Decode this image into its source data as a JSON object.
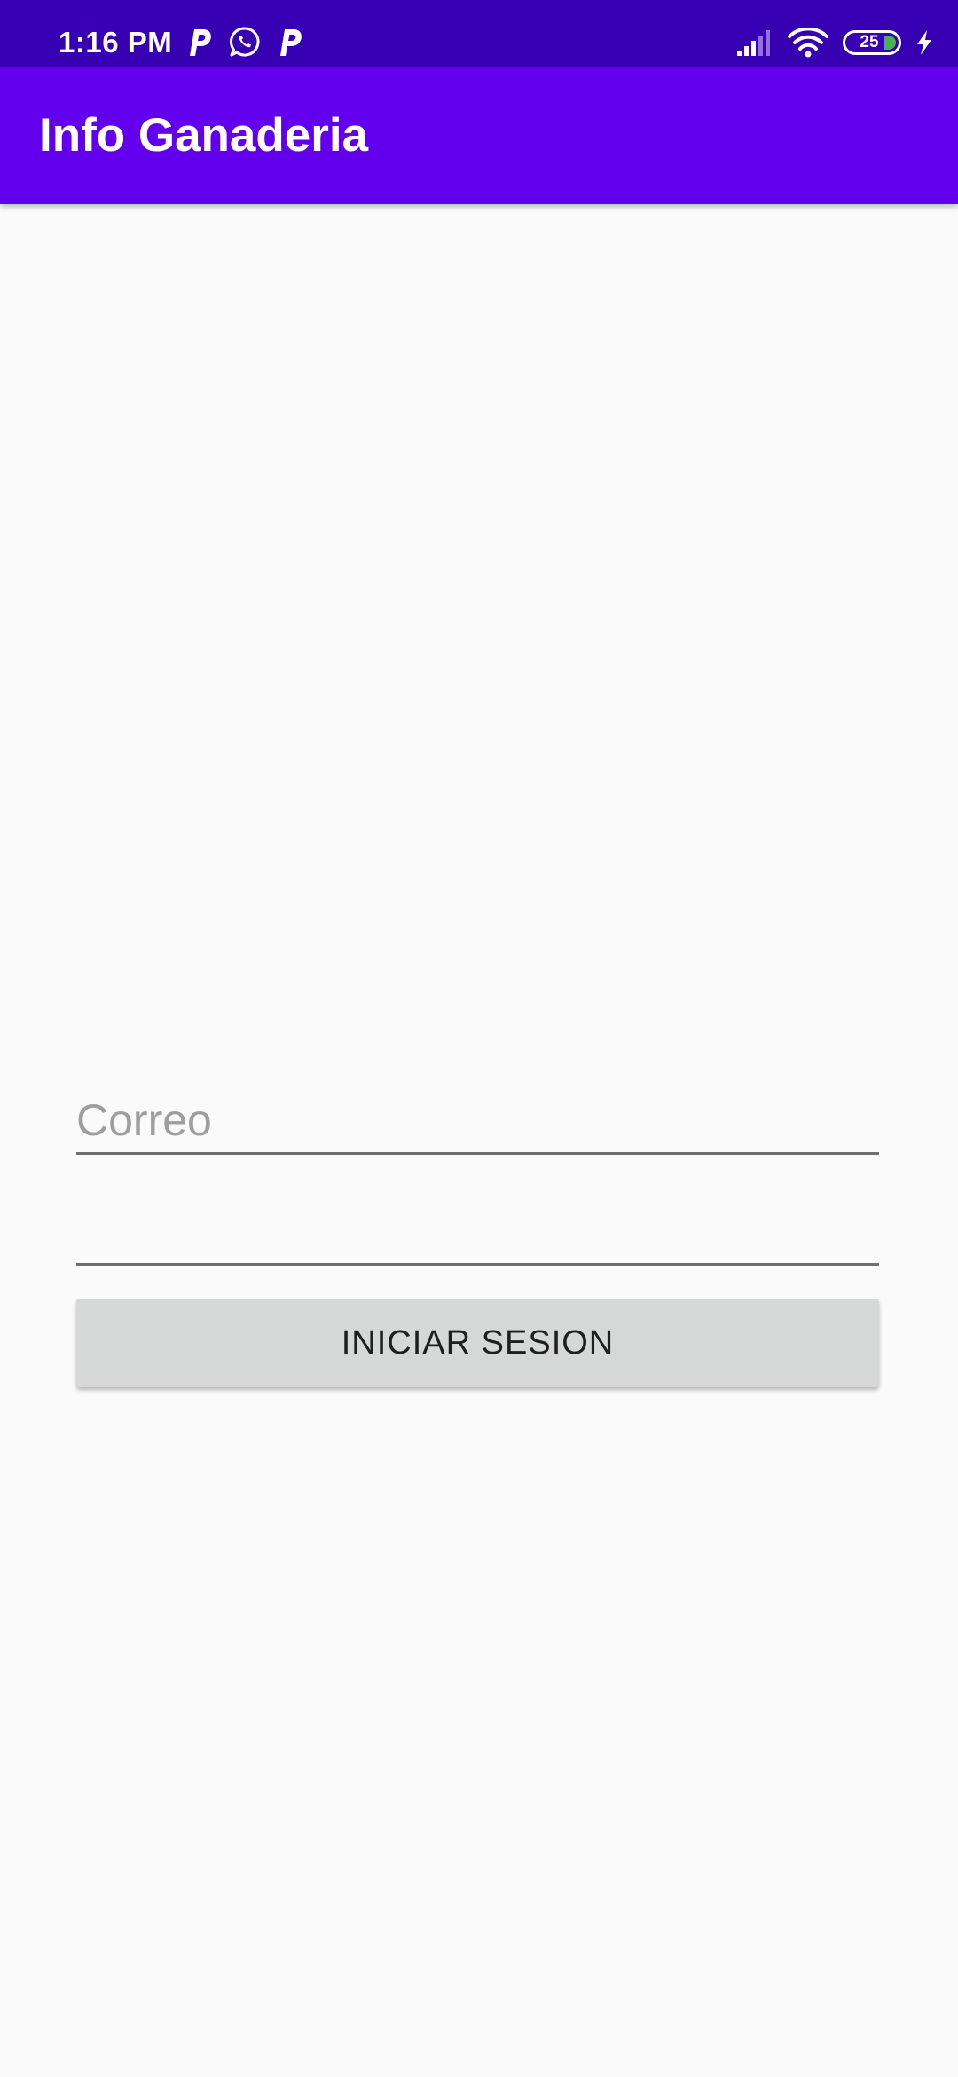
{
  "status_bar": {
    "time": "1:16 PM",
    "notification_icons": [
      "parking-app-icon",
      "whatsapp-icon",
      "parking-app-icon"
    ],
    "battery_level": "25",
    "system_icons": [
      "signal-icon",
      "wifi-icon",
      "battery-icon",
      "charging-icon"
    ]
  },
  "app_bar": {
    "title": "Info Ganaderia",
    "color": "#6200ee"
  },
  "form": {
    "email_placeholder": "Correo",
    "password_placeholder": "",
    "login_label": "INICIAR SESION"
  },
  "colors": {
    "status_bar": "#3700b3",
    "app_bar": "#6200ee",
    "background": "#fafafa",
    "button": "#d6d7d7"
  }
}
